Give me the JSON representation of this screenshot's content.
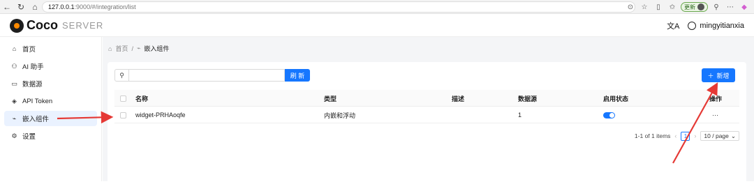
{
  "browser": {
    "url_host": "127.0.0.1",
    "url_rest": ":9000/#/integration/list",
    "update_label": "更新"
  },
  "header": {
    "logo_text": "Coco",
    "logo_sub": "SERVER",
    "translate_icon": "文A",
    "username": "mingyitianxia"
  },
  "sidebar": {
    "items": [
      {
        "label": "首页",
        "icon": "home-icon"
      },
      {
        "label": "AI 助手",
        "icon": "robot-icon"
      },
      {
        "label": "数据源",
        "icon": "folder-icon"
      },
      {
        "label": "API Token",
        "icon": "shield-icon"
      },
      {
        "label": "嵌入组件",
        "icon": "embed-icon"
      },
      {
        "label": "设置",
        "icon": "gear-icon"
      }
    ]
  },
  "breadcrumb": {
    "home": "首页",
    "current": "嵌入组件"
  },
  "toolbar": {
    "refresh_label": "刷 新",
    "add_label": "新增"
  },
  "table": {
    "headers": {
      "name": "名称",
      "type": "类型",
      "desc": "描述",
      "datasource": "数据源",
      "enabled": "启用状态",
      "action": "操作"
    },
    "rows": [
      {
        "name": "widget-PRHAoqfe",
        "type": "内嵌和浮动",
        "desc": "",
        "datasource": "1",
        "enabled": true,
        "action": "···"
      }
    ]
  },
  "pagination": {
    "summary": "1-1 of 1 items",
    "current_page": "1",
    "page_size": "10 / page"
  },
  "colors": {
    "primary": "#1677ff",
    "annotation": "#e53935"
  }
}
